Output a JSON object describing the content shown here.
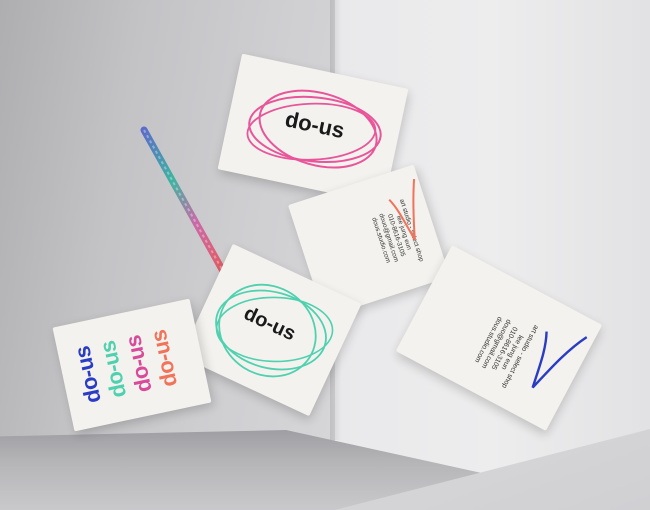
{
  "logo": "do-us",
  "cards": {
    "card_top_logo": "do-us",
    "card_mid_logo": "do-us",
    "stack": [
      "do-us",
      "do-us",
      "do-us",
      "do-us"
    ],
    "contact": [
      "art studio - select shop",
      "lee jung eun",
      "010-8616-3105",
      "douo@gmail.com",
      "dous.studio.com"
    ],
    "contact2": [
      "art studio - select shop",
      "lee jung eun",
      "010-8616-3105",
      "douo@gmail.com",
      "dous.studio.com"
    ]
  },
  "colors": {
    "pink": "#e8559a",
    "teal": "#4fd1b0",
    "blue": "#2a3cc4",
    "coral": "#f0735a",
    "magenta": "#d94a9a"
  }
}
